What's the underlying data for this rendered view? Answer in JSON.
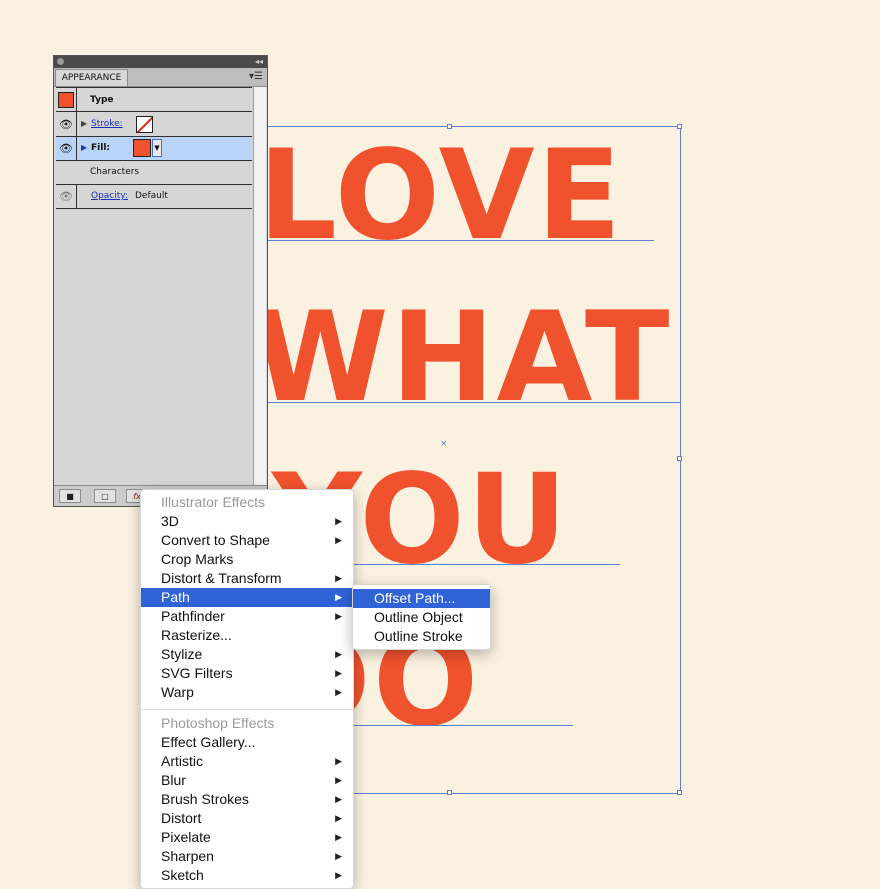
{
  "artboard": {
    "words": [
      "LOVE",
      "WHAT",
      "YOU",
      "DO"
    ],
    "type_color": "#f0522d",
    "selection_color": "#5b7fd6"
  },
  "appearance_panel": {
    "tab_label": "APPEARANCE",
    "rows": {
      "type": {
        "label": "Type",
        "swatch_color": "#f0522d"
      },
      "stroke": {
        "label": "Stroke:",
        "value": "none"
      },
      "fill": {
        "label": "Fill:",
        "swatch_color": "#f0522d"
      },
      "characters": {
        "label": "Characters"
      },
      "opacity": {
        "label": "Opacity:",
        "value": "Default"
      }
    },
    "icons": [
      "eye-icon",
      "expand-triangle-icon",
      "new-art-icon",
      "clear-appearance-icon",
      "fx-icon"
    ],
    "fx_label": "fx"
  },
  "effect_menu": {
    "illustrator_header": "Illustrator Effects",
    "illustrator_items": [
      {
        "label": "3D",
        "submenu": true
      },
      {
        "label": "Convert to Shape",
        "submenu": true
      },
      {
        "label": "Crop Marks",
        "submenu": false
      },
      {
        "label": "Distort & Transform",
        "submenu": true
      },
      {
        "label": "Path",
        "submenu": true,
        "highlighted": true
      },
      {
        "label": "Pathfinder",
        "submenu": true
      },
      {
        "label": "Rasterize...",
        "submenu": false
      },
      {
        "label": "Stylize",
        "submenu": true
      },
      {
        "label": "SVG Filters",
        "submenu": true
      },
      {
        "label": "Warp",
        "submenu": true
      }
    ],
    "photoshop_header": "Photoshop Effects",
    "photoshop_items": [
      {
        "label": "Effect Gallery...",
        "submenu": false
      },
      {
        "label": "Artistic",
        "submenu": true
      },
      {
        "label": "Blur",
        "submenu": true
      },
      {
        "label": "Brush Strokes",
        "submenu": true
      },
      {
        "label": "Distort",
        "submenu": true
      },
      {
        "label": "Pixelate",
        "submenu": true
      },
      {
        "label": "Sharpen",
        "submenu": true
      },
      {
        "label": "Sketch",
        "submenu": true
      }
    ]
  },
  "path_submenu": {
    "items": [
      {
        "label": "Offset Path...",
        "highlighted": true
      },
      {
        "label": "Outline Object",
        "highlighted": false
      },
      {
        "label": "Outline Stroke",
        "highlighted": false
      }
    ]
  },
  "highlight_color": "#2f63d6"
}
